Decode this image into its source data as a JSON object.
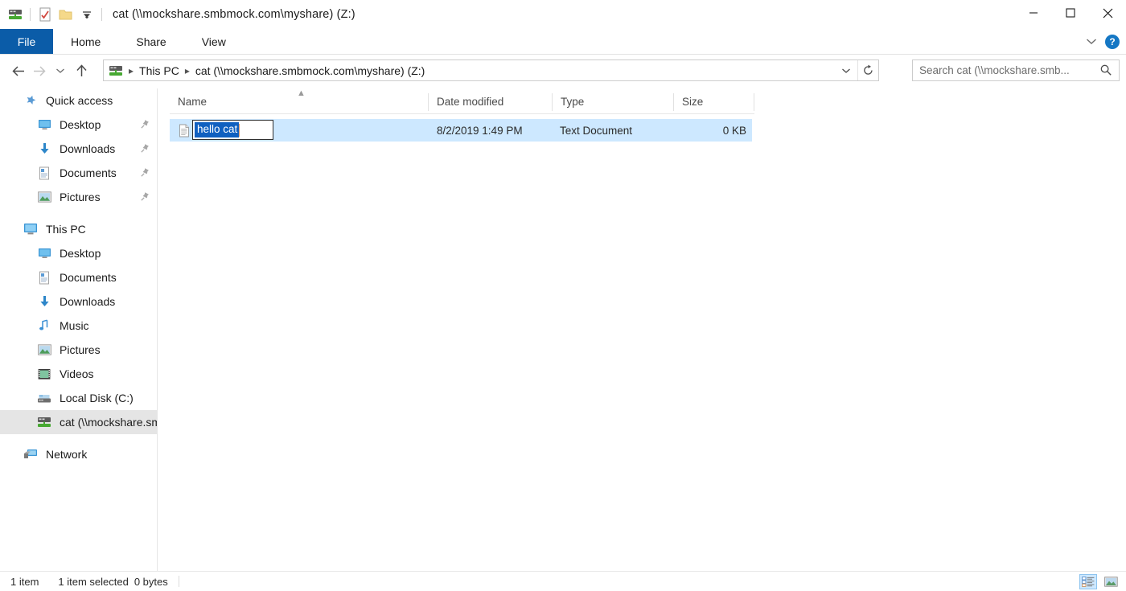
{
  "window": {
    "title": "cat (\\\\mockshare.smbmock.com\\myshare) (Z:)",
    "quick_access_toolbar": [
      {
        "name": "network-drive-icon",
        "label": "cat (\\\\mockshare.smbmock.com\\myshare) (Z:)"
      },
      {
        "name": "properties-icon",
        "label": "Properties"
      },
      {
        "name": "new-folder-icon",
        "label": "New folder"
      },
      {
        "name": "customize-qat-chevron-icon",
        "label": "Customize Quick Access Toolbar"
      }
    ],
    "controls": {
      "minimize": "Minimize",
      "maximize": "Maximize",
      "close": "Close"
    }
  },
  "ribbon": {
    "tabs": [
      {
        "label": "File",
        "active": true
      },
      {
        "label": "Home",
        "active": false
      },
      {
        "label": "Share",
        "active": false
      },
      {
        "label": "View",
        "active": false
      }
    ],
    "collapse_label": "Minimize the Ribbon",
    "help_label": "?"
  },
  "navigation": {
    "back_label": "Back",
    "forward_label": "Forward",
    "recent_label": "Recent locations",
    "up_label": "Up to This PC",
    "breadcrumb": [
      {
        "label": "This PC"
      },
      {
        "label": "cat (\\\\mockshare.smbmock.com\\myshare) (Z:)"
      }
    ],
    "address_dropdown_label": "Previous Locations",
    "refresh_label": "Refresh"
  },
  "search": {
    "placeholder": "Search cat (\\\\mockshare.smb...",
    "value": ""
  },
  "sidebar": {
    "groups": [
      {
        "header": {
          "label": "Quick access",
          "icon": "star-pin-icon"
        },
        "items": [
          {
            "label": "Desktop",
            "icon": "desktop-icon",
            "pinned": true
          },
          {
            "label": "Downloads",
            "icon": "downloads-icon",
            "pinned": true
          },
          {
            "label": "Documents",
            "icon": "documents-icon",
            "pinned": true
          },
          {
            "label": "Pictures",
            "icon": "pictures-icon",
            "pinned": true
          }
        ]
      },
      {
        "header": {
          "label": "This PC",
          "icon": "this-pc-icon"
        },
        "items": [
          {
            "label": "Desktop",
            "icon": "desktop-icon",
            "pinned": false
          },
          {
            "label": "Documents",
            "icon": "documents-icon",
            "pinned": false
          },
          {
            "label": "Downloads",
            "icon": "downloads-icon",
            "pinned": false
          },
          {
            "label": "Music",
            "icon": "music-icon",
            "pinned": false
          },
          {
            "label": "Pictures",
            "icon": "pictures-icon",
            "pinned": false
          },
          {
            "label": "Videos",
            "icon": "videos-icon",
            "pinned": false
          },
          {
            "label": "Local Disk (C:)",
            "icon": "local-disk-icon",
            "pinned": false
          },
          {
            "label": "cat (\\\\mockshare.sm",
            "icon": "network-drive-icon",
            "pinned": false,
            "selected": true
          }
        ]
      },
      {
        "header": {
          "label": "Network",
          "icon": "network-icon"
        },
        "items": []
      }
    ]
  },
  "file_list": {
    "columns": [
      {
        "label": "Name",
        "sorted": "asc"
      },
      {
        "label": "Date modified"
      },
      {
        "label": "Type"
      },
      {
        "label": "Size"
      }
    ],
    "rows": [
      {
        "name": "hello cat",
        "icon": "text-document-icon",
        "date_modified": "8/2/2019 1:49 PM",
        "type": "Text Document",
        "size": "0 KB",
        "selected": true,
        "renaming": true
      }
    ]
  },
  "status_bar": {
    "item_count": "1 item",
    "selection_count": "1 item selected",
    "selection_size": "0 bytes",
    "views": [
      {
        "name": "details-view-button",
        "label": "Details view",
        "active": true
      },
      {
        "name": "large-icons-view-button",
        "label": "Large icons view",
        "active": false
      }
    ]
  },
  "colors": {
    "accent": "#0b5ca8",
    "selection": "#cde8ff",
    "rename_selection": "#1060c0",
    "nav_selected": "#e5e5e5"
  }
}
